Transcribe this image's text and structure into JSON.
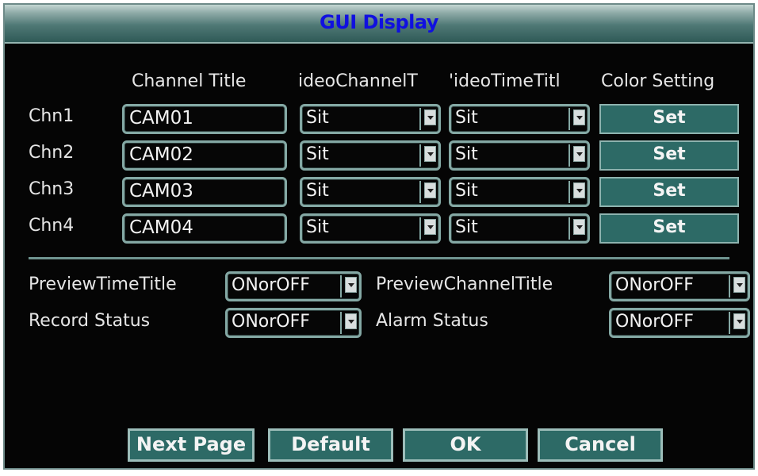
{
  "window": {
    "title": "GUI Display"
  },
  "headers": {
    "channel_title": "Channel Title",
    "video_channel_title": "ideoChannelT",
    "video_time_title": "'ideoTimeTitl",
    "color_setting": "Color Setting"
  },
  "channels": [
    {
      "label": "Chn1",
      "title": "CAM01",
      "channel_title_mode": "Sit",
      "time_title_mode": "Sit",
      "set_label": "Set"
    },
    {
      "label": "Chn2",
      "title": "CAM02",
      "channel_title_mode": "Sit",
      "time_title_mode": "Sit",
      "set_label": "Set"
    },
    {
      "label": "Chn3",
      "title": "CAM03",
      "channel_title_mode": "Sit",
      "time_title_mode": "Sit",
      "set_label": "Set"
    },
    {
      "label": "Chn4",
      "title": "CAM04",
      "channel_title_mode": "Sit",
      "time_title_mode": "Sit",
      "set_label": "Set"
    }
  ],
  "options": {
    "preview_time_title": {
      "label": "PreviewTimeTitle",
      "value": "ONorOFF"
    },
    "preview_channel_title": {
      "label": "PreviewChannelTitle",
      "value": "ONorOFF"
    },
    "record_status": {
      "label": "Record Status",
      "value": "ONorOFF"
    },
    "alarm_status": {
      "label": "Alarm Status",
      "value": "ONorOFF"
    }
  },
  "buttons": {
    "next_page": "Next Page",
    "default": "Default",
    "ok": "OK",
    "cancel": "Cancel"
  },
  "colors": {
    "title_text": "#1010e0",
    "button_bg": "#2d6a66",
    "field_border": "#84a8a4",
    "background": "#050505"
  },
  "icons": [
    "dropdown-arrow-icon"
  ]
}
